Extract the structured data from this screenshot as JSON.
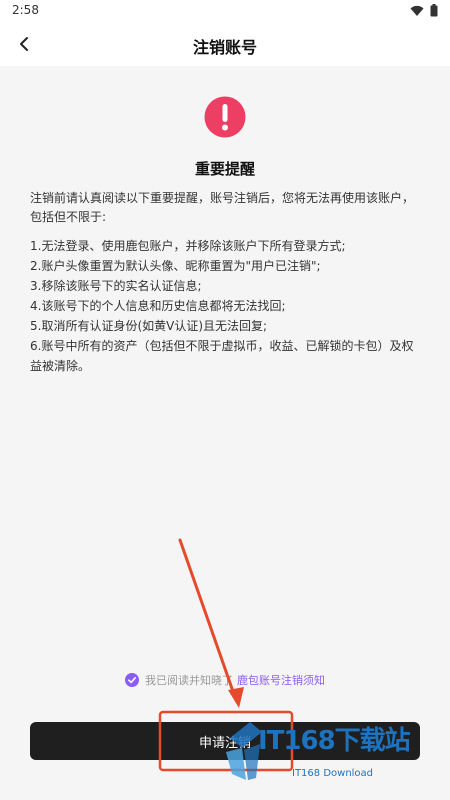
{
  "status_bar": {
    "time": "2:58"
  },
  "nav": {
    "title": "注销账号"
  },
  "notice": {
    "title": "重要提醒",
    "intro": "注销前请认真阅读以下重要提醒，账号注销后，您将无法再使用该账户，包括但不限于:",
    "items": [
      "1.无法登录、使用鹿包账户，并移除该账户下所有登录方式;",
      "2.账户头像重置为默认头像、昵称重置为\"用户已注销\";",
      "3.移除该账号下的实名认证信息;",
      "4.该账号下的个人信息和历史信息都将无法找回;",
      "5.取消所有认证身份(如黄V认证)且无法回复;",
      "6.账号中所有的资产（包括但不限于虚拟币，收益、已解锁的卡包）及权益被清除。"
    ]
  },
  "agreement": {
    "prefix": "我已阅读并知晓了",
    "link": "鹿包账号注销须知"
  },
  "apply_button": {
    "label": "申请注销"
  },
  "watermark": {
    "main": "IT168下载站",
    "sub": "IT168 Download"
  },
  "colors": {
    "accent": "#8b5cf6",
    "alert": "#ec3f63",
    "button_bg": "#1f1f1f",
    "annotation": "#e34b2c"
  },
  "icons": [
    "back-arrow-icon",
    "wifi-icon",
    "battery-icon",
    "exclamation-icon",
    "check-circle-icon"
  ]
}
